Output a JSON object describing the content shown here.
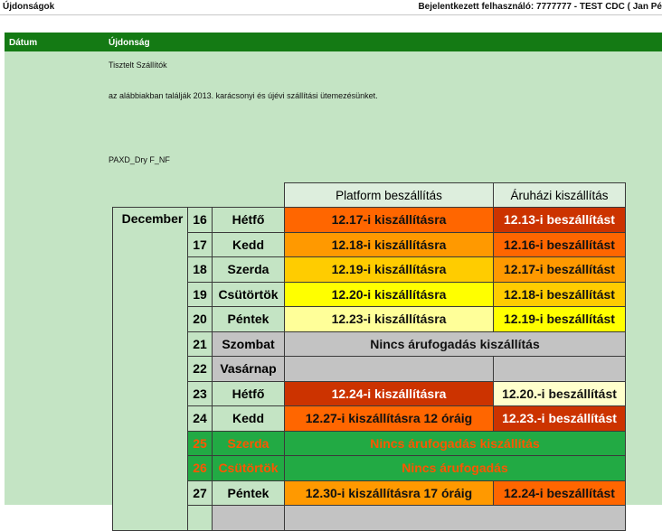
{
  "topbar": {
    "title": "Újdonságok",
    "user_line": "Bejelentkezett felhasználó: 7777777 - TEST CDC ( Jan Pé"
  },
  "table_header": {
    "col_date": "Dátum",
    "col_news": "Újdonság"
  },
  "message": {
    "greeting": "Tisztelt Szállítók",
    "body": "az alábbiakban találják 2013. karácsonyi és újévi szállítási ütemezésünket.",
    "code": "PAXD_Dry F_NF"
  },
  "schedule": {
    "headers": {
      "platform": "Platform beszállítás",
      "store": "Áruházi kiszállítás"
    },
    "month": "December",
    "rows": [
      {
        "num": "16",
        "day": "Hétfő",
        "platform": "12.17-i kiszállításra",
        "store": "12.13-i beszállítást",
        "pcolor": "#ff6600",
        "scolor": "#cc3300",
        "pfont": "#111111",
        "sfont": "#ffffff"
      },
      {
        "num": "17",
        "day": "Kedd",
        "platform": "12.18-i kiszállításra",
        "store": "12.16-i beszállítást",
        "pcolor": "#ff9900",
        "scolor": "#ff6600",
        "pfont": "#111111",
        "sfont": "#111111"
      },
      {
        "num": "18",
        "day": "Szerda",
        "platform": "12.19-i kiszállításra",
        "store": "12.17-i beszállítást",
        "pcolor": "#ffcc00",
        "scolor": "#ff9900",
        "pfont": "#111111",
        "sfont": "#111111"
      },
      {
        "num": "19",
        "day": "Csütörtök",
        "platform": "12.20-i kiszállításra",
        "store": "12.18-i beszállítást",
        "pcolor": "#ffff00",
        "scolor": "#ffcc00",
        "pfont": "#111111",
        "sfont": "#111111"
      },
      {
        "num": "20",
        "day": "Péntek",
        "platform": "12.23-i kiszállításra",
        "store": "12.19-i beszállítást",
        "pcolor": "#ffff99",
        "scolor": "#ffff00",
        "pfont": "#111111",
        "sfont": "#111111"
      },
      {
        "num": "21",
        "day": "Szombat",
        "merged": "Nincs árufogadás kiszállítás",
        "mcolor": "#c3c3c3",
        "mfont": "#111111"
      },
      {
        "num": "22",
        "day": "Vasárnap",
        "platform": "",
        "store": "",
        "pcolor": "#c3c3c3",
        "scolor": "#c3c3c3",
        "pfont": "#111111",
        "sfont": "#111111"
      },
      {
        "num": "23",
        "day": "Hétfő",
        "platform": "12.24-i kiszállításra",
        "store": "12.20.-i beszállítást",
        "pcolor": "#cc3300",
        "scolor": "#ffffcc",
        "pfont": "#ffffff",
        "sfont": "#111111"
      },
      {
        "num": "24",
        "day": "Kedd",
        "platform": "12.27-i kiszállításra 12 óráig",
        "store": "12.23.-i beszállítást",
        "pcolor": "#ff6600",
        "scolor": "#cc3300",
        "pfont": "#111111",
        "sfont": "#ffffff"
      },
      {
        "num": "25",
        "day": "Szerda",
        "merged": "Nincs árufogadás kiszállítás",
        "mcolor": "#22aa44",
        "mfont": "#ff5500",
        "highlight": true
      },
      {
        "num": "26",
        "day": "Csütörtök",
        "merged": "Nincs árufogadás",
        "mcolor": "#22aa44",
        "mfont": "#ff5500",
        "highlight": true
      },
      {
        "num": "27",
        "day": "Péntek",
        "platform": "12.30-i kiszállításra 17 óráig",
        "store": "12.24-i beszállítást",
        "pcolor": "#ff9900",
        "scolor": "#ff6600",
        "pfont": "#111111",
        "sfont": "#111111"
      }
    ]
  }
}
